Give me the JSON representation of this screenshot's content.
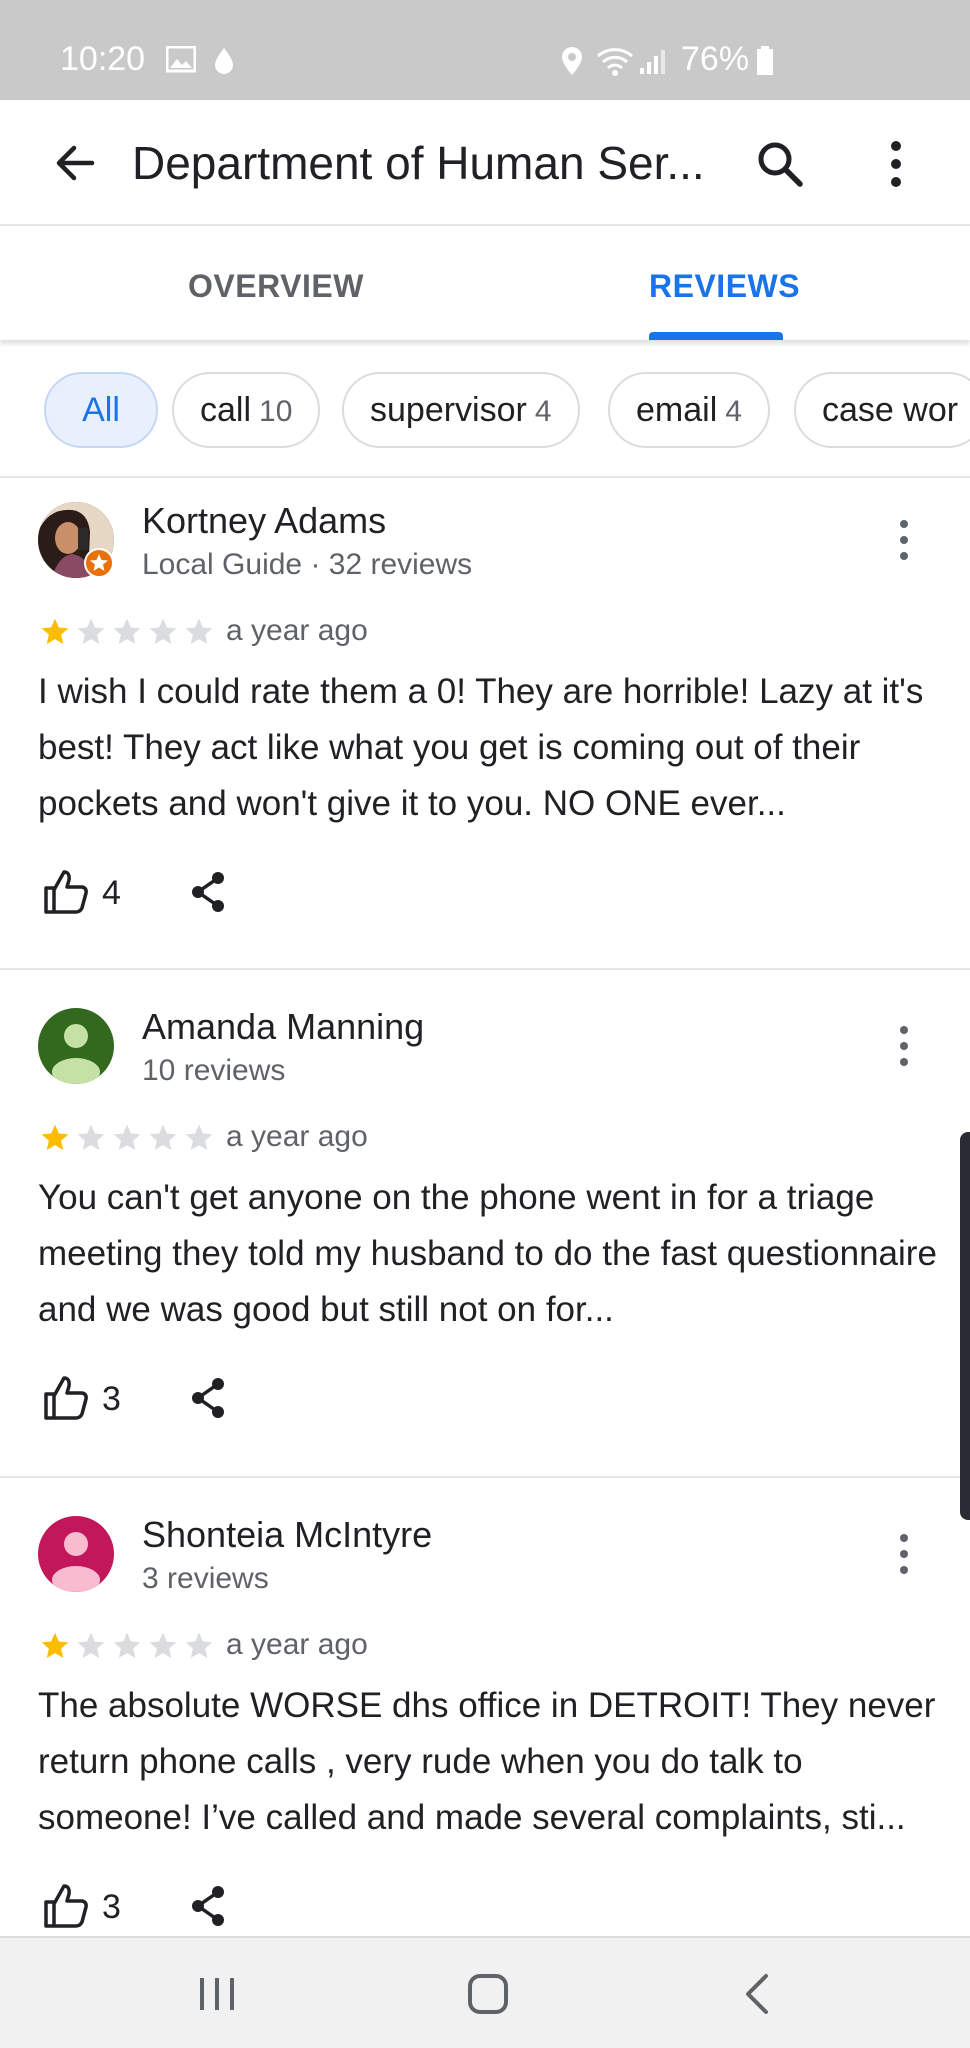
{
  "status_bar": {
    "time": "10:20",
    "battery": "76%",
    "icons": [
      "image-icon",
      "drop-icon",
      "location-icon",
      "wifi-icon",
      "signal-icon",
      "battery-icon"
    ]
  },
  "app_bar": {
    "title": "Department of Human Ser...",
    "icons": [
      "back-arrow-icon",
      "search-icon",
      "more-vert-icon"
    ]
  },
  "tabs": [
    {
      "label": "OVERVIEW",
      "selected": false
    },
    {
      "label": "REVIEWS",
      "selected": true
    }
  ],
  "filter_chips": [
    {
      "label": "All",
      "count": "",
      "selected": true
    },
    {
      "label": "call",
      "count": "10",
      "selected": false
    },
    {
      "label": "supervisor",
      "count": "4",
      "selected": false
    },
    {
      "label": "email",
      "count": "4",
      "selected": false
    },
    {
      "label": "case wor",
      "count": "",
      "selected": false
    }
  ],
  "reviews": [
    {
      "name": "Kortney Adams",
      "meta": "Local Guide · 32 reviews",
      "rating": 1,
      "max_rating": 5,
      "date": "a year ago",
      "text": "I wish I could rate them a 0! They are horrible! Lazy at it's best! They act like what you get is coming out of their pockets and won't give it to you. NO ONE ever...",
      "likes": "4",
      "avatar": "photo",
      "local_guide_badge": true
    },
    {
      "name": "Amanda Manning",
      "meta": "10 reviews",
      "rating": 1,
      "max_rating": 5,
      "date": "a year ago",
      "text": "You can't get anyone on the phone went in for a triage meeting they told my husband to do the fast questionnaire and we was good but still not on for...",
      "likes": "3",
      "avatar": "default",
      "avatar_color": "#33691e"
    },
    {
      "name": "Shonteia McIntyre",
      "meta": "3 reviews",
      "rating": 1,
      "max_rating": 5,
      "date": "a year ago",
      "text": "The absolute WORSE dhs office in DETROIT! They never return phone calls , very rude when you do talk to someone! I’ve called and made several complaints, sti...",
      "likes": "3",
      "avatar": "default",
      "avatar_color": "#c2185b"
    }
  ],
  "colors": {
    "accent": "#1a73e8",
    "star_filled": "#fbbc04",
    "star_empty": "#dadce0",
    "status_bar": "#c9c9c9"
  },
  "nav_bar": {
    "icons": [
      "recents-icon",
      "home-icon",
      "back-icon"
    ]
  }
}
